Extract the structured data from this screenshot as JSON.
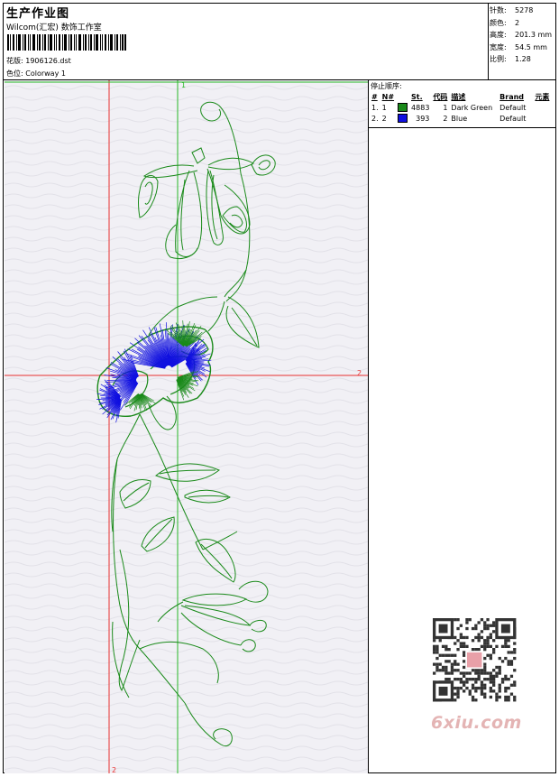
{
  "header": {
    "title": "生产作业图",
    "company": "Wilcom(汇宏) 数饰工作室",
    "design_label": "花版:",
    "design_value": "1906126.dst",
    "colorway_label": "色位:",
    "colorway_value": "Colorway 1"
  },
  "stats": [
    {
      "label": "针数:",
      "value": "5278"
    },
    {
      "label": "颜色:",
      "value": "2"
    },
    {
      "label": "高度:",
      "value": "201.3 mm"
    },
    {
      "label": "宽度:",
      "value": "54.5 mm"
    },
    {
      "label": "比例:",
      "value": "1.28"
    }
  ],
  "stop_sequence": {
    "title": "停止顺序:",
    "columns": [
      "#",
      "N#",
      "St.",
      "代码",
      "描述",
      "Brand",
      "元素"
    ],
    "rows": [
      {
        "index": "1.",
        "needle": "1",
        "color": "#1a8a1a",
        "stitches": "4883",
        "code": "1",
        "description": "Dark Green",
        "brand": "Default",
        "element": ""
      },
      {
        "index": "2.",
        "needle": "2",
        "color": "#1010e0",
        "stitches": "393",
        "code": "2",
        "description": "Blue",
        "brand": "Default",
        "element": ""
      }
    ]
  },
  "guides": {
    "label_top": "1",
    "label_right": "2",
    "label_bottom": "2"
  },
  "colors": {
    "guide_red": "#e83030",
    "guide_green": "#28b828",
    "thread_green": "#1a8a1a",
    "thread_blue": "#1010e0"
  },
  "watermark": {
    "text": "6xiu.com"
  }
}
